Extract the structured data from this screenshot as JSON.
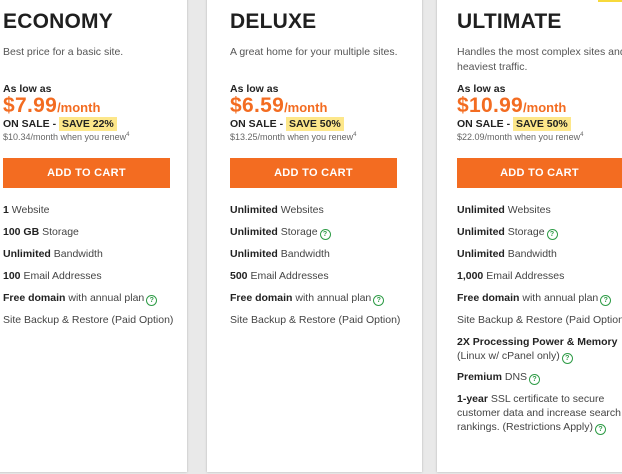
{
  "plans": [
    {
      "name": "ECONOMY",
      "description": [
        "Best price for a basic site."
      ],
      "as_low_as": "As low as",
      "price": "$7.99",
      "per": "/month",
      "on_sale": "ON SALE -",
      "save": "SAVE 22%",
      "renew": "$10.34/month when you renew",
      "renew_note": "4",
      "cart": "ADD TO CART",
      "features": [
        {
          "bold": "1",
          "text": " Website",
          "help": false
        },
        {
          "bold": "100 GB",
          "text": " Storage",
          "help": false
        },
        {
          "bold": "Unlimited",
          "text": " Bandwidth",
          "help": false
        },
        {
          "bold": "100",
          "text": " Email Addresses",
          "help": false
        },
        {
          "bold": "Free domain",
          "text": " with annual plan",
          "help": true
        },
        {
          "bold": "",
          "text": "Site Backup & Restore (Paid Option)",
          "help": false
        }
      ]
    },
    {
      "name": "DELUXE",
      "description": [
        "A great home for your multiple sites."
      ],
      "as_low_as": "As low as",
      "price": "$6.59",
      "per": "/month",
      "on_sale": "ON SALE -",
      "save": "SAVE 50%",
      "renew": "$13.25/month when you renew",
      "renew_note": "4",
      "cart": "ADD TO CART",
      "features": [
        {
          "bold": "Unlimited",
          "text": " Websites",
          "help": false
        },
        {
          "bold": "Unlimited",
          "text": " Storage",
          "help": true
        },
        {
          "bold": "Unlimited",
          "text": " Bandwidth",
          "help": false
        },
        {
          "bold": "500",
          "text": " Email Addresses",
          "help": false
        },
        {
          "bold": "Free domain",
          "text": " with annual plan",
          "help": true
        },
        {
          "bold": "",
          "text": "Site Backup & Restore (Paid Option)",
          "help": false
        }
      ]
    },
    {
      "name": "ULTIMATE",
      "description": [
        "Handles the most complex sites and",
        "heaviest traffic."
      ],
      "as_low_as": "As low as",
      "price": "$10.99",
      "per": "/month",
      "on_sale": "ON SALE -",
      "save": "SAVE 50%",
      "renew": "$22.09/month when you renew",
      "renew_note": "4",
      "cart": "ADD TO CART",
      "features": [
        {
          "bold": "Unlimited",
          "text": " Websites",
          "help": false
        },
        {
          "bold": "Unlimited",
          "text": " Storage",
          "help": true
        },
        {
          "bold": "Unlimited",
          "text": " Bandwidth",
          "help": false
        },
        {
          "bold": "1,000",
          "text": " Email Addresses",
          "help": false
        },
        {
          "bold": "Free domain",
          "text": " with annual plan",
          "help": true
        },
        {
          "bold": "",
          "text": "Site Backup & Restore (Paid Option)",
          "help": false
        },
        {
          "bold": "2X  Processing Power & Memory",
          "text": "",
          "help": false,
          "line2": "(Linux w/ cPanel only)",
          "line2_help": true
        },
        {
          "bold": "Premium",
          "text": " DNS",
          "help": true
        },
        {
          "bold": "1-year",
          "text": " SSL certificate to secure",
          "help": false,
          "line2": "customer data and increase search",
          "line3": "rankings. (Restrictions Apply)",
          "line3_help": true
        }
      ]
    }
  ],
  "colors": {
    "accent": "#f36c21",
    "highlight": "#fde78a",
    "help": "#2f9c47"
  },
  "icons": {
    "help": "?"
  }
}
